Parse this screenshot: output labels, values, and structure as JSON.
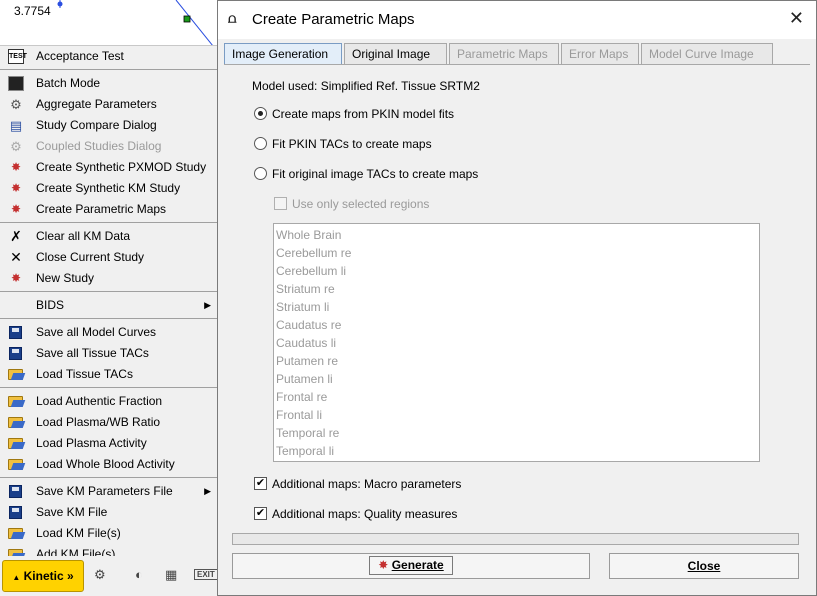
{
  "plot": {
    "value_label": "3.7754"
  },
  "menu": {
    "groups": [
      [
        {
          "label": "Acceptance Test",
          "icon": "test-icon",
          "disabled": false
        }
      ],
      [
        {
          "label": "Batch Mode",
          "icon": "console-icon",
          "disabled": false
        },
        {
          "label": "Aggregate Parameters",
          "icon": "gear-icon",
          "disabled": false
        },
        {
          "label": "Study Compare Dialog",
          "icon": "compare-icon",
          "disabled": false
        },
        {
          "label": "Coupled Studies Dialog",
          "icon": "gear-icon",
          "disabled": true
        },
        {
          "label": "Create Synthetic PXMOD Study",
          "icon": "synthetic-icon",
          "disabled": false
        },
        {
          "label": "Create Synthetic KM Study",
          "icon": "synthetic-icon",
          "disabled": false
        },
        {
          "label": "Create Parametric Maps",
          "icon": "synthetic-icon",
          "disabled": false
        }
      ],
      [
        {
          "label": "Clear all KM Data",
          "icon": "clear-icon",
          "disabled": false
        },
        {
          "label": "Close Current Study",
          "icon": "close-icon",
          "disabled": false
        },
        {
          "label": "New Study",
          "icon": "synthetic-icon",
          "disabled": false
        }
      ],
      [
        {
          "label": "BIDS",
          "icon": "",
          "disabled": false,
          "submenu": true
        }
      ],
      [
        {
          "label": "Save all Model Curves",
          "icon": "save-icon",
          "disabled": false
        },
        {
          "label": "Save all Tissue TACs",
          "icon": "save-icon",
          "disabled": false
        },
        {
          "label": "Load Tissue TACs",
          "icon": "folder-icon",
          "disabled": false
        }
      ],
      [
        {
          "label": "Load Authentic Fraction",
          "icon": "folder-icon",
          "disabled": false
        },
        {
          "label": "Load Plasma/WB Ratio",
          "icon": "folder-icon",
          "disabled": false
        },
        {
          "label": "Load Plasma Activity",
          "icon": "folder-icon",
          "disabled": false
        },
        {
          "label": "Load Whole Blood Activity",
          "icon": "folder-icon",
          "disabled": false
        }
      ],
      [
        {
          "label": "Save KM Parameters File",
          "icon": "save-icon",
          "disabled": false,
          "submenu": true
        },
        {
          "label": "Save KM File",
          "icon": "save-icon",
          "disabled": false
        },
        {
          "label": "Load KM File(s)",
          "icon": "folder-icon",
          "disabled": false
        },
        {
          "label": "Add KM File(s)",
          "icon": "folder-icon",
          "disabled": false
        }
      ]
    ]
  },
  "toolbar": {
    "kinetic_label": "Kinetic »",
    "exit_label": "EXIT"
  },
  "dialog": {
    "title": "Create Parametric Maps",
    "tabs": [
      {
        "label": "Image Generation",
        "active": true,
        "disabled": false
      },
      {
        "label": "Original Image",
        "active": false,
        "disabled": false
      },
      {
        "label": "Parametric Maps",
        "active": false,
        "disabled": true
      },
      {
        "label": "Error Maps",
        "active": false,
        "disabled": true
      },
      {
        "label": "Model Curve Image",
        "active": false,
        "disabled": true
      }
    ],
    "model_used": "Model used: Simplified Ref. Tissue SRTM2",
    "radio_pkin_fits": "Create maps from PKIN model fits",
    "radio_pkin_tacs": "Fit PKIN TACs to create maps",
    "radio_original_tacs": "Fit original image TACs to create maps",
    "use_selected_regions": "Use only selected regions",
    "regions": [
      "Whole Brain",
      "Cerebellum re",
      "Cerebellum li",
      "Striatum re",
      "Striatum li",
      "Caudatus re",
      "Caudatus li",
      "Putamen re",
      "Putamen li",
      "Frontal re",
      "Frontal li",
      "Temporal re",
      "Temporal li"
    ],
    "additional_macro": "Additional maps: Macro parameters",
    "additional_quality": "Additional maps: Quality measures",
    "generate_label": "Generate",
    "close_label": "Close"
  }
}
